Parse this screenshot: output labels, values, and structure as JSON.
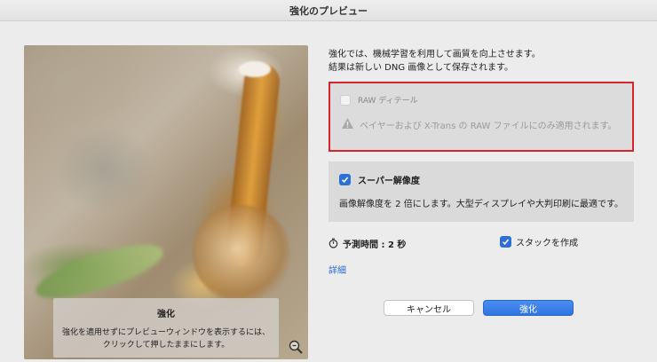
{
  "window": {
    "title": "強化のプレビュー"
  },
  "preview": {
    "hint_title": "強化",
    "hint_line1": "強化を適用せずにプレビューウィンドウを表示するには、",
    "hint_line2": "クリックして押したままにします。",
    "zoom_icon": "zoom-icon"
  },
  "description": {
    "line1": "強化では、機械学習を利用して画質を向上させます。",
    "line2": "結果は新しい DNG 画像として保存されます。"
  },
  "raw_detail": {
    "label": "RAW ディテール",
    "checked": false,
    "enabled": false,
    "warning": "ベイヤーおよび X-Trans の RAW ファイルにのみ適用されます。",
    "warning_icon": "warning-icon",
    "highlight_color": "#d9232a"
  },
  "super_resolution": {
    "label": "スーパー解像度",
    "checked": true,
    "description": "画像解像度を 2 倍にします。大型ディスプレイや大判印刷に最適です。"
  },
  "estimate": {
    "label": "予測時間 : 2 秒",
    "icon": "stopwatch-icon"
  },
  "stack": {
    "label": "スタックを作成",
    "checked": true
  },
  "details_link": "詳細",
  "buttons": {
    "cancel": "キャンセル",
    "enhance": "強化"
  },
  "colors": {
    "accent": "#2f74e0",
    "background": "#ececec"
  }
}
